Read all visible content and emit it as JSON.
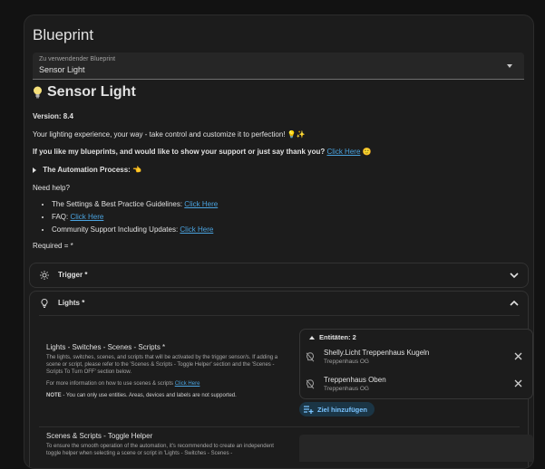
{
  "card": {
    "title": "Blueprint"
  },
  "blueprint_select": {
    "label": "Zu verwendender Blueprint",
    "value": "Sensor Light"
  },
  "heading": "Sensor Light",
  "version": "Version: 8.4",
  "tagline": {
    "text": "Your lighting experience, your way - take control and customize it to perfection!",
    "emoji": "💡✨"
  },
  "support": {
    "text": "If you like my blueprints, and would like to show your support or just say thank you?",
    "link": "Click Here",
    "emoji": "🙂"
  },
  "automation_process": {
    "label": "The Automation Process:",
    "emoji": "👈"
  },
  "need_help": "Need help?",
  "help_links": [
    {
      "prefix": "The Settings & Best Practice Guidelines: ",
      "link": "Click Here"
    },
    {
      "prefix": "FAQ: ",
      "link": "Click Here"
    },
    {
      "prefix": "Community Support Including Updates: ",
      "link": "Click Here"
    }
  ],
  "required_note": "Required = *",
  "trigger_panel": {
    "title": "Trigger *",
    "icon": "gear-icon"
  },
  "lights_panel": {
    "title": "Lights *",
    "icon": "lightbulb-icon",
    "section1": {
      "title": "Lights - Switches - Scenes - Scripts *",
      "desc": "The lights, switches, scenes, and scripts that will be activated by the trigger sensor/s. If adding a scene or script, please refer to the 'Scenes & Scripts - Toggle Helper' section and the 'Scenes - Scripts To Turn OFF' section below.",
      "more_info": "For more information on how to use scenes & scripts",
      "more_info_link": "Click Here",
      "note_label": "NOTE",
      "note_text": " - You can only use entities. Areas, devices and labels are not supported."
    },
    "entities": {
      "header": "Entitäten: 2",
      "items": [
        {
          "name": "Shelly.Licht Treppenhaus Kugeln",
          "area": "Treppenhaus OG"
        },
        {
          "name": "Treppenhaus Oben",
          "area": "Treppenhaus OG"
        }
      ],
      "add_label": "Ziel hinzufügen"
    },
    "section2": {
      "title": "Scenes & Scripts - Toggle Helper",
      "desc": "To ensure the smooth operation of the automation, it's recommended to create an independent toggle helper when selecting a scene or script in 'Lights - Switches - Scenes -"
    }
  },
  "colors": {
    "link": "#4aa3df",
    "accent": "#79c3ff",
    "background": "#121212",
    "card": "#1c1c1c"
  }
}
